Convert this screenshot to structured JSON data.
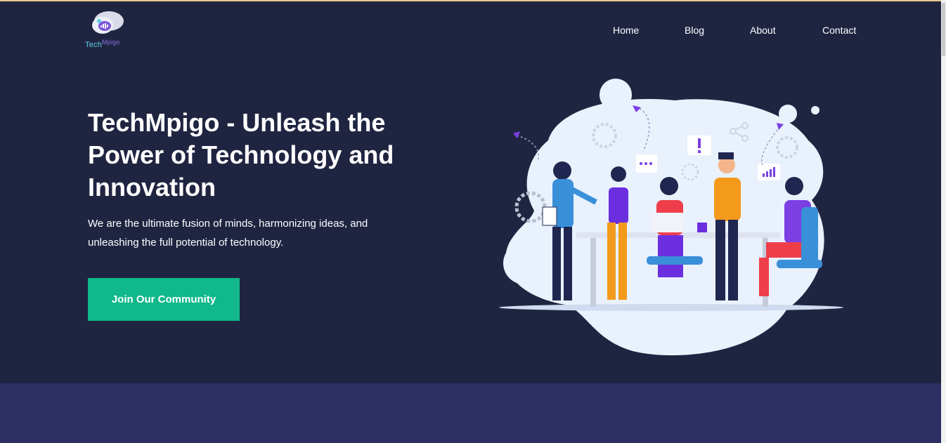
{
  "brand": {
    "part1": "Tech",
    "part2": "Mpigo"
  },
  "nav": [
    {
      "label": "Home"
    },
    {
      "label": "Blog"
    },
    {
      "label": "About"
    },
    {
      "label": "Contact"
    }
  ],
  "hero": {
    "title": "TechMpigo - Unleash the Power of Technology and Innovation",
    "subtitle": "We are the ultimate fusion of minds, harmonizing ideas, and unleashing the full potential of technology.",
    "cta_label": "Join Our Community"
  },
  "colors": {
    "hero_bg": "#1f2541",
    "section_bg": "#2e3063",
    "accent": "#10b88a"
  },
  "icons": [
    "logo-mic-icon",
    "team-illustration"
  ]
}
